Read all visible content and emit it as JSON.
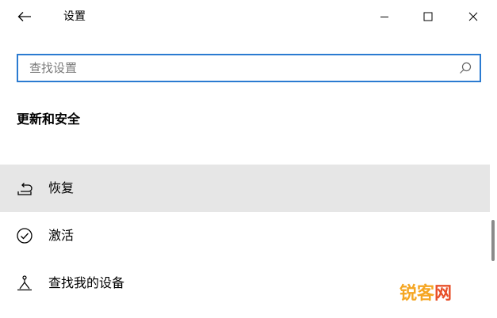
{
  "window": {
    "title": "设置"
  },
  "search": {
    "value": "",
    "placeholder": "查找设置"
  },
  "section": {
    "heading": "更新和安全"
  },
  "nav": {
    "items": [
      {
        "label": "恢复",
        "icon": "recovery-icon",
        "selected": true
      },
      {
        "label": "激活",
        "icon": "activation-check-icon",
        "selected": false
      },
      {
        "label": "查找我的设备",
        "icon": "find-device-icon",
        "selected": false
      }
    ]
  },
  "watermark": {
    "part1": "锐客",
    "part2": "网"
  },
  "colors": {
    "accent": "#2b7bd1",
    "selected_bg": "#e6e6e6",
    "text": "#000000",
    "placeholder": "#7a7a7a",
    "watermark_orange": "#f5a623",
    "watermark_red": "#e8502a"
  }
}
